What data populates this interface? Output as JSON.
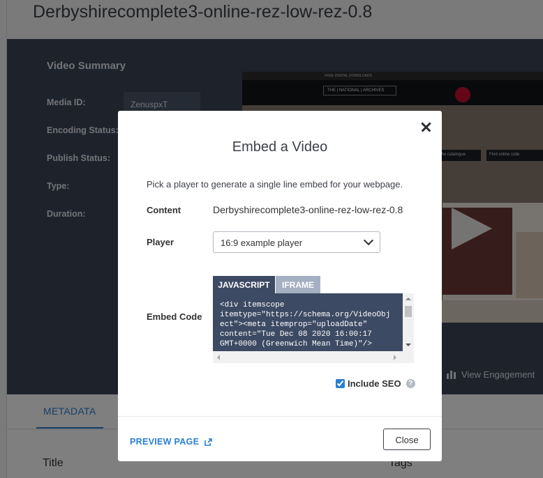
{
  "page": {
    "title": "Derbyshirecomplete3-online-rez-low-rez-0.8"
  },
  "summary": {
    "heading": "Video Summary",
    "labels": {
      "media_id": "Media ID:",
      "encoding_status": "Encoding Status:",
      "publish_status": "Publish Status:",
      "type": "Type:",
      "duration": "Duration:"
    },
    "media_id_value": "ZenuspxT"
  },
  "thumbnail": {
    "topbar_text": "FREE DIGITAL DOWNLOADS",
    "logo_text": "THE | NATIONAL | ARCHIVES",
    "button1": "the catalogue",
    "button2": "Find online colle"
  },
  "actions": {
    "view_engagement": "View Engagement"
  },
  "tabs": {
    "metadata": "METADATA"
  },
  "fields": {
    "title": "Title",
    "tags": "Tags"
  },
  "modal": {
    "title": "Embed a Video",
    "intro": "Pick a player to generate a single line embed for your webpage.",
    "content_label": "Content",
    "content_value": "Derbyshirecomplete3-online-rez-low-rez-0.8",
    "player_label": "Player",
    "player_selected": "16:9 example player",
    "embed_label": "Embed Code",
    "code_tabs": {
      "javascript": "JAVASCRIPT",
      "iframe": "IFRAME"
    },
    "code": "<div itemscope\nitemtype=\"https://schema.org/VideoObj\nect\"><meta itemprop=\"uploadDate\"\ncontent=\"Tue Dec 08 2020 16:00:17\nGMT+0000 (Greenwich Mean Time)\"/>",
    "include_seo_label": "Include SEO",
    "include_seo_checked": true,
    "preview_label": "PREVIEW PAGE",
    "close_label": "Close"
  },
  "colors": {
    "accent": "#2a7fd4",
    "panel": "#3c4557",
    "code_bg": "#3d4a63",
    "inactive_tab": "#a6b0c3"
  }
}
